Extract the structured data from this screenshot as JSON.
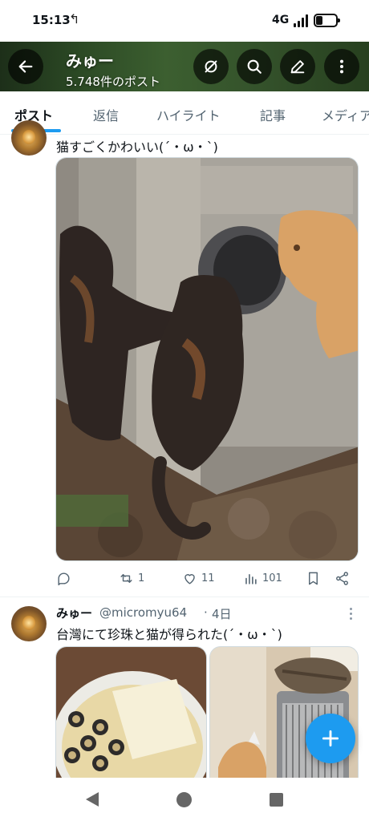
{
  "status_bar": {
    "time": "15:13",
    "network": "4G"
  },
  "header": {
    "title": "みゅー",
    "post_count": "5.748件のポスト",
    "icons": [
      "back-arrow-icon",
      "grok-icon",
      "search-icon",
      "edit-icon",
      "more-icon"
    ]
  },
  "tabs": [
    {
      "label": "ポスト",
      "active": true
    },
    {
      "label": "返信"
    },
    {
      "label": "ハイライト"
    },
    {
      "label": "記事"
    },
    {
      "label": "メディア"
    }
  ],
  "posts": [
    {
      "text": "猫すごくかわいい(´・ω・`)",
      "image": "cat-photo",
      "actions": {
        "replies": "",
        "reposts": "1",
        "likes": "11",
        "views": "101"
      }
    },
    {
      "author": "みゅー",
      "handle": "@micromyu64",
      "separator": "·",
      "date": "4日",
      "text": "台灣にて珍珠と猫が得られた(´・ω・`)",
      "images": [
        "bubble-tea-photo",
        "cats-on-heater-photo"
      ]
    }
  ],
  "fab": {
    "icon": "plus-icon"
  },
  "colors": {
    "accent": "#1d9bf0",
    "text": "#0f1419",
    "secondary": "#536471"
  }
}
